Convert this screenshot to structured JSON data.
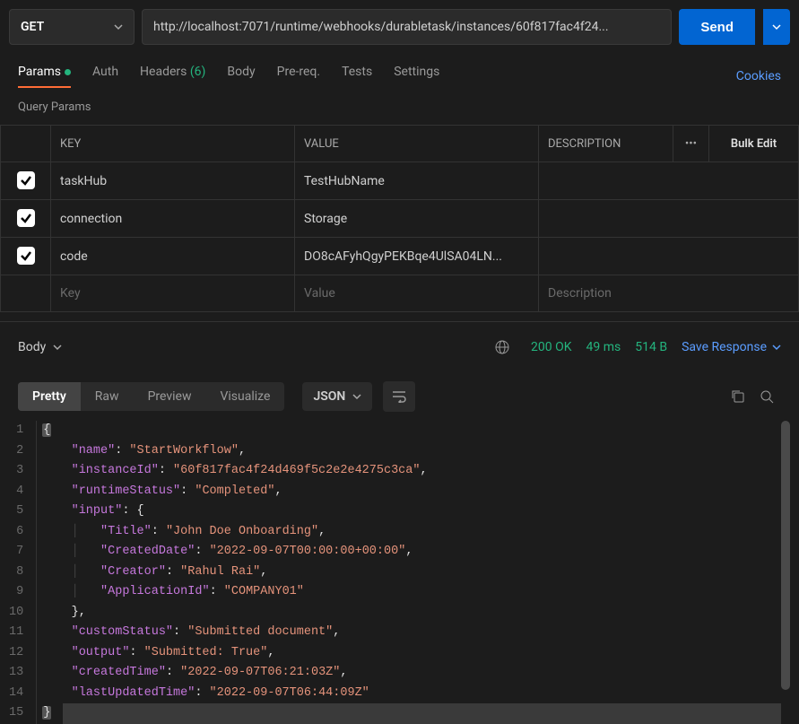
{
  "request": {
    "method": "GET",
    "url": "http://localhost:7071/runtime/webhooks/durabletask/instances/60f817fac4f24..."
  },
  "send_label": "Send",
  "tabs": {
    "params": "Params",
    "auth": "Auth",
    "headers": "Headers",
    "headers_count": "(6)",
    "body": "Body",
    "prereq": "Pre-req.",
    "tests": "Tests",
    "settings": "Settings",
    "cookies": "Cookies"
  },
  "query_params_title": "Query Params",
  "table": {
    "headers": {
      "key": "KEY",
      "value": "VALUE",
      "description": "DESCRIPTION",
      "bulk": "Bulk Edit"
    },
    "rows": [
      {
        "key": "taskHub",
        "value": "TestHubName"
      },
      {
        "key": "connection",
        "value": "Storage"
      },
      {
        "key": "code",
        "value": "DO8cAFyhQgyPEKBqe4UlSA04LN..."
      }
    ],
    "placeholder": {
      "key": "Key",
      "value": "Value",
      "description": "Description"
    }
  },
  "response": {
    "body_label": "Body",
    "status": "200 OK",
    "time": "49 ms",
    "size": "514 B",
    "save": "Save Response"
  },
  "viewmodes": {
    "pretty": "Pretty",
    "raw": "Raw",
    "preview": "Preview",
    "visualize": "Visualize",
    "type": "JSON"
  },
  "json_body": {
    "name": "StartWorkflow",
    "instanceId": "60f817fac4f24d469f5c2e2e4275c3ca",
    "runtimeStatus": "Completed",
    "input": {
      "Title": "John Doe Onboarding",
      "CreatedDate": "2022-09-07T00:00:00+00:00",
      "Creator": "Rahul Rai",
      "ApplicationId": "COMPANY01"
    },
    "customStatus": "Submitted document",
    "output": "Submitted: True",
    "createdTime": "2022-09-07T06:21:03Z",
    "lastUpdatedTime": "2022-09-07T06:44:09Z"
  }
}
